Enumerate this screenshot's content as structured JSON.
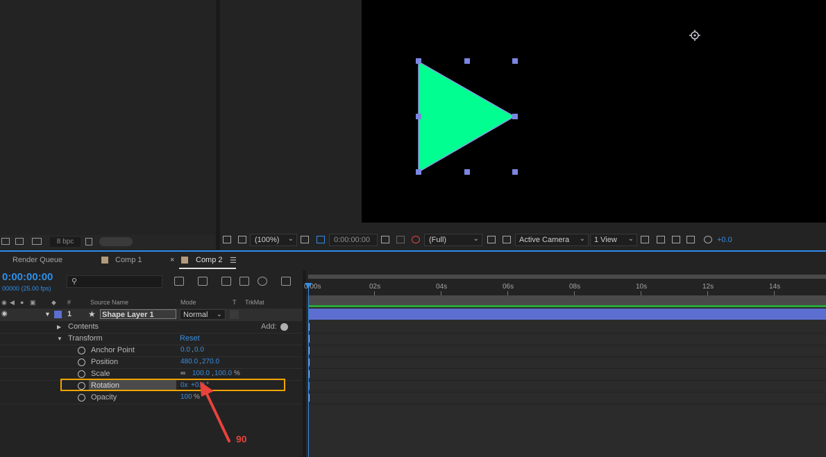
{
  "project_footer": {
    "bpc": "8 bpc"
  },
  "viewer": {
    "zoom": "(100%)",
    "timecode": "0:00:00:00",
    "resolution": "(Full)",
    "camera": "Active Camera",
    "views": "1 View",
    "exposure": "+0.0",
    "shape_color": "#00ff90",
    "canvas_color": "#000000"
  },
  "tabs": {
    "render_queue": "Render Queue",
    "comp1": "Comp 1",
    "close_glyph": "×",
    "comp2": "Comp 2",
    "menu_glyph": "☰"
  },
  "timeline": {
    "timecode": "0:00:00:00",
    "fps": "00000 (25.00 fps)",
    "columns": {
      "num": "#",
      "source": "Source Name",
      "mode": "Mode",
      "t": "T",
      "trkmat": "TrkMat"
    },
    "layer": {
      "index": "1",
      "name": "Shape Layer 1",
      "mode": "Normal"
    },
    "contents_label": "Contents",
    "add_label": "Add:",
    "transform_label": "Transform",
    "reset_label": "Reset",
    "properties": [
      {
        "name": "Anchor Point",
        "value_a": "0.0",
        "sep": ",",
        "value_b": "0.0",
        "unit": ""
      },
      {
        "name": "Position",
        "value_a": "480.0",
        "sep": ",",
        "value_b": "270.0",
        "unit": ""
      },
      {
        "name": "Scale",
        "value_a": "100.0",
        "sep": ",",
        "value_b": "100.0",
        "unit": "%"
      },
      {
        "name": "Rotation",
        "value_a": "0x",
        "sep": " ",
        "value_b": "+0.0",
        "unit": "°"
      },
      {
        "name": "Opacity",
        "value_a": "100",
        "sep": "",
        "value_b": "",
        "unit": "%"
      }
    ],
    "ruler_ticks": [
      "0:00s",
      "02s",
      "04s",
      "06s",
      "08s",
      "10s",
      "12s",
      "14s"
    ]
  },
  "annotation": {
    "label": "90",
    "color": "#e8433b"
  }
}
